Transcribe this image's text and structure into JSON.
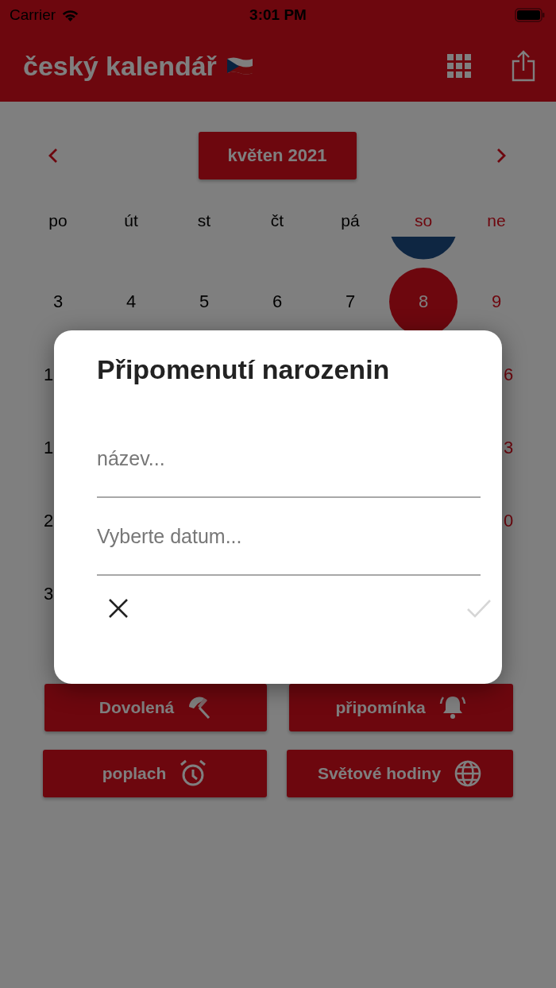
{
  "status_bar": {
    "carrier": "Carrier",
    "time": "3:01 PM"
  },
  "header": {
    "title": "český kalendář"
  },
  "calendar": {
    "month": "květen 2021",
    "weekdays": [
      {
        "label": "po",
        "weekend": false
      },
      {
        "label": "út",
        "weekend": false
      },
      {
        "label": "st",
        "weekend": false
      },
      {
        "label": "čt",
        "weekend": false
      },
      {
        "label": "pá",
        "weekend": false
      },
      {
        "label": "so",
        "weekend": true
      },
      {
        "label": "ne",
        "weekend": true
      }
    ],
    "week": [
      {
        "label": "3",
        "selected": false
      },
      {
        "label": "4",
        "selected": false
      },
      {
        "label": "5",
        "selected": false
      },
      {
        "label": "6",
        "selected": false
      },
      {
        "label": "7",
        "selected": false
      },
      {
        "label": "8",
        "selected": true
      },
      {
        "label": "9",
        "selected": false
      }
    ],
    "rows_behind_dialog": [
      {
        "first": "1",
        "last": "6"
      },
      {
        "first": "1",
        "last": "3"
      },
      {
        "first": "2",
        "last": "0"
      },
      {
        "first": "3"
      }
    ]
  },
  "actions": [
    {
      "label": "Dovolená",
      "kind": "vacation"
    },
    {
      "label": "připomínka",
      "kind": "reminder"
    },
    {
      "label": "poplach",
      "kind": "alarm"
    },
    {
      "label": "Světové hodiny",
      "kind": "world-clock"
    }
  ],
  "dialog": {
    "title": "Připomenutí narozenin",
    "fields": [
      {
        "placeholder": "název..."
      },
      {
        "placeholder": "Vyberte datum..."
      }
    ],
    "confirm_disabled": true
  }
}
